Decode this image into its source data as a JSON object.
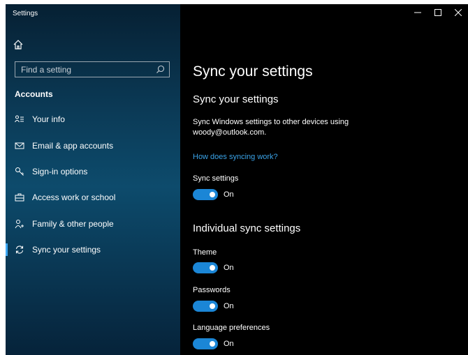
{
  "window": {
    "title": "Settings"
  },
  "sidebar": {
    "search_placeholder": "Find a setting",
    "section": "Accounts",
    "items": [
      {
        "label": "Your info",
        "icon": "person-card-icon"
      },
      {
        "label": "Email & app accounts",
        "icon": "envelope-icon"
      },
      {
        "label": "Sign-in options",
        "icon": "key-icon"
      },
      {
        "label": "Access work or school",
        "icon": "briefcase-icon"
      },
      {
        "label": "Family & other people",
        "icon": "add-person-icon"
      },
      {
        "label": "Sync your settings",
        "icon": "sync-icon",
        "active": true
      }
    ]
  },
  "main": {
    "page_title": "Sync your settings",
    "section1_title": "Sync your settings",
    "description": "Sync Windows settings to other devices using woody@outlook.com.",
    "help_link": "How does syncing work?",
    "sync_settings": {
      "label": "Sync settings",
      "state": "On"
    },
    "section2_title": "Individual sync settings",
    "individual": [
      {
        "label": "Theme",
        "state": "On"
      },
      {
        "label": "Passwords",
        "state": "On"
      },
      {
        "label": "Language preferences",
        "state": "On"
      }
    ]
  },
  "colors": {
    "accent": "#1b86d6",
    "link": "#3aa3e8",
    "background": "#000000"
  }
}
